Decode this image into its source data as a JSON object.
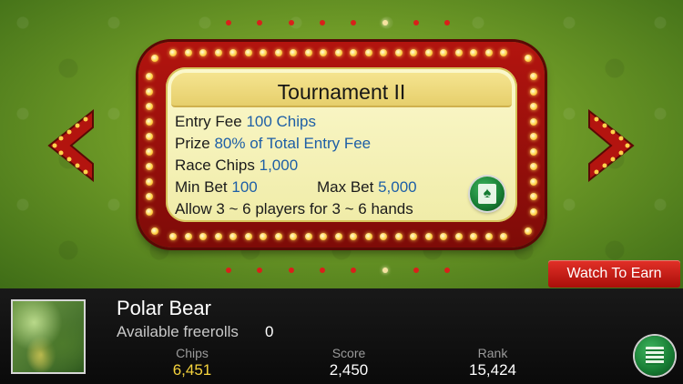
{
  "colors": {
    "felt": "#6e9a27",
    "marquee_red": "#b3140f",
    "bulb": "#ffd24a",
    "value_blue": "#1e5fa6",
    "chips_gold": "#f5d33d"
  },
  "pager": {
    "count": 8,
    "active_index": 5
  },
  "tournament": {
    "title": "Tournament II",
    "entry_fee_label": "Entry Fee",
    "entry_fee_value": "100 Chips",
    "prize_label": "Prize",
    "prize_value": "80% of Total Entry Fee",
    "race_chips_label": "Race Chips",
    "race_chips_value": "1,000",
    "min_bet_label": "Min Bet",
    "min_bet_value": "100",
    "max_bet_label": "Max Bet",
    "max_bet_value": "5,000",
    "players_text": "Allow 3 ~ 6 players for 3 ~ 6 hands",
    "spade_icon": "spade-card-icon"
  },
  "nav": {
    "prev_icon": "chevron-left-icon",
    "next_icon": "chevron-right-icon"
  },
  "watch_to_earn_label": "Watch To Earn",
  "player": {
    "name": "Polar Bear",
    "freerolls_label": "Available freerolls",
    "freerolls_value": "0",
    "chips_label": "Chips",
    "chips_value": "6,451",
    "score_label": "Score",
    "score_value": "2,450",
    "rank_label": "Rank",
    "rank_value": "15,424",
    "menu_icon": "list-menu-icon"
  }
}
